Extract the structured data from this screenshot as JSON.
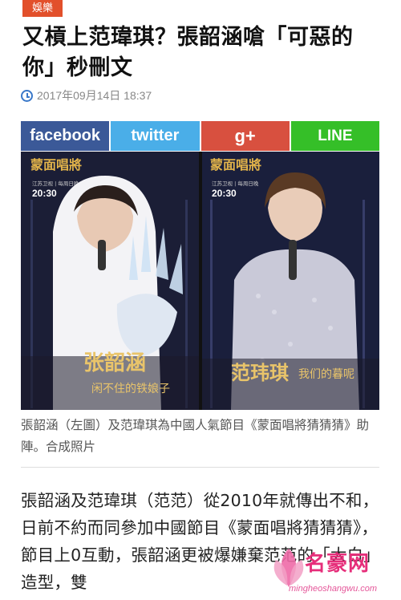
{
  "article": {
    "category": "娛樂",
    "title": "又槓上范瑋琪？張韶涵嗆「可惡的你」秒刪文",
    "date": "2017年09月14日 18:37"
  },
  "share": {
    "facebook": "facebook",
    "twitter": "twitter",
    "gplus": "g+",
    "line": "LINE"
  },
  "photo": {
    "show_logo": "蒙面唱將",
    "channel": "江苏卫视 | 每周日晚",
    "time": "20:30",
    "left_name": "张韶涵",
    "left_sub": "闲不住的铁娘子",
    "right_name": "范玮琪",
    "right_sub": "我们的暮呢"
  },
  "caption": "張韶涵（左圖）及范瑋琪為中國人氣節目《蒙面唱將猜猜猜》助陣。合成照片",
  "body_text": "張韶涵及范瑋琪（范范）從2010年就傳出不和，日前不約而同參加中國節目《蒙面唱將猜猜猜》，節目上0互動，張韶涵更被爆嫌棄范范的「大白」造型，雙",
  "watermark": {
    "name": "名豪网",
    "domain": "mingheoshangwu.com"
  },
  "colors": {
    "badge": "#e2502b",
    "facebook": "#3b5998",
    "twitter": "#4aaee8",
    "gplus": "#d8503f",
    "line": "#35bf28"
  }
}
